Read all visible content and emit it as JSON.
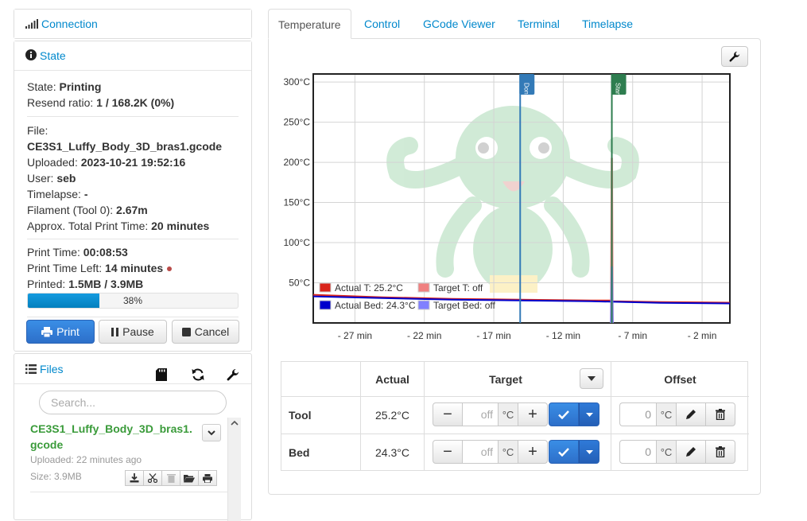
{
  "sidebar": {
    "connection": {
      "label": "Connection",
      "icon": "signal-icon"
    },
    "state": {
      "label": "State",
      "icon": "info-circle-icon",
      "state_label": "State:",
      "state_value": "Printing",
      "resend_label": "Resend ratio:",
      "resend_value": "1 / 168.2K (0%)",
      "file_label": "File:",
      "file_value": "CE3S1_Luffy_Body_3D_bras1.gcode",
      "uploaded_label": "Uploaded:",
      "uploaded_value": "2023-10-21 19:52:16",
      "user_label": "User:",
      "user_value": "seb",
      "timelapse_label": "Timelapse:",
      "timelapse_value": "-",
      "filament_label": "Filament (Tool 0):",
      "filament_value": "2.67m",
      "total_label": "Approx. Total Print Time:",
      "total_value": "20 minutes",
      "printtime_label": "Print Time:",
      "printtime_value": "00:08:53",
      "left_label": "Print Time Left:",
      "left_value": "14 minutes",
      "printed_label": "Printed:",
      "printed_value": "1.5MB / 3.9MB",
      "progress_text": "38%",
      "progress_fraction": 0.34,
      "buttons": {
        "print": "Print",
        "pause": "Pause",
        "cancel": "Cancel"
      }
    },
    "files": {
      "label": "Files",
      "search_placeholder": "Search...",
      "item": {
        "name": "CE3S1_Luffy_Body_3D_bras1.gcode",
        "uploaded": "Uploaded: 22 minutes ago",
        "size": "Size: 3.9MB"
      }
    }
  },
  "tabs": [
    "Temperature",
    "Control",
    "GCode Viewer",
    "Terminal",
    "Timelapse"
  ],
  "chart_data": {
    "type": "line",
    "xlabel": "",
    "ylabel": "",
    "x_unit": "minutes (relative)",
    "xlim": [
      -30,
      0
    ],
    "ylim": [
      0,
      310
    ],
    "x_ticks": [
      -27,
      -22,
      -17,
      -12,
      -7,
      -2
    ],
    "x_tick_labels": [
      "- 27 min",
      "- 22 min",
      "- 17 min",
      "- 12 min",
      "- 7 min",
      "- 2 min"
    ],
    "y_ticks": [
      50,
      100,
      150,
      200,
      250,
      300
    ],
    "y_tick_labels": [
      "50°C",
      "100°C",
      "150°C",
      "200°C",
      "250°C",
      "300°C"
    ],
    "grid": true,
    "markers": [
      {
        "label": "Done",
        "x": -15.1,
        "color": "#337ab7"
      },
      {
        "label": "Start",
        "x": -8.5,
        "color": "#2e7d4f"
      }
    ],
    "series": [
      {
        "name": "Actual T: 25.2°C",
        "color": "#d9241b",
        "x": [
          -30,
          -25,
          -20,
          -15,
          -10,
          -8.5,
          -8.4,
          -5,
          0
        ],
        "y": [
          35,
          32,
          30,
          29,
          28,
          28,
          27,
          26,
          25.2
        ]
      },
      {
        "name": "Target T: off",
        "color": "#f08080",
        "x": [
          -8.6,
          -8.55,
          -8.45,
          -8.4
        ],
        "y": [
          0,
          205,
          205,
          0
        ]
      },
      {
        "name": "Actual Bed: 24.3°C",
        "color": "#0000cc",
        "x": [
          -30,
          -25,
          -20,
          -15,
          -10,
          -5,
          0
        ],
        "y": [
          33,
          31,
          29,
          28,
          27,
          25,
          24.3
        ]
      },
      {
        "name": "Target Bed: off",
        "color": "#8080ff",
        "x": [
          -8.6,
          -8.55,
          -8.45,
          -8.4
        ],
        "y": [
          0,
          70,
          70,
          0
        ]
      }
    ],
    "legend_position": "bottom-left"
  },
  "temp_table": {
    "headers": {
      "actual": "Actual",
      "target": "Target",
      "offset": "Offset"
    },
    "rows": [
      {
        "name": "Tool",
        "actual": "25.2°C",
        "target_placeholder": "off",
        "offset": "0"
      },
      {
        "name": "Bed",
        "actual": "24.3°C",
        "target_placeholder": "off",
        "offset": "0"
      }
    ],
    "unit": "°C",
    "minus": "−",
    "plus": "+"
  },
  "colors": {
    "link": "#0088cc",
    "primary": "#337ab7",
    "file_green": "#3a9b3a"
  }
}
